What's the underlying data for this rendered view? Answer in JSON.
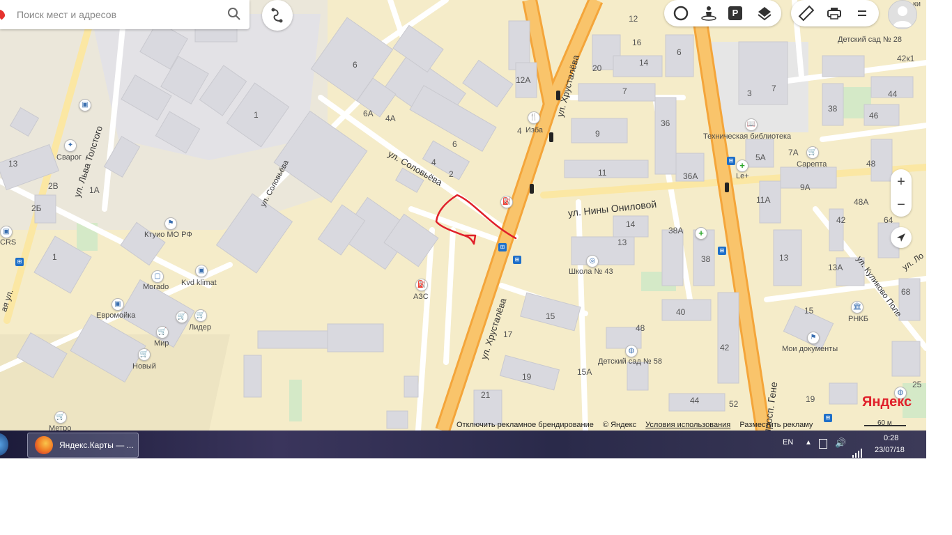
{
  "search": {
    "placeholder": "Поиск мест и адресов"
  },
  "map": {
    "streets": [
      "ул. Хрусталёва",
      "ул. Хрусталёва",
      "ул. Соловьёва",
      "ул. Соловьёва",
      "ул. Льва Толстого",
      "ул. Нины Ониловой",
      "просп. Гене",
      "ул. Куликово Поле",
      "ул. Ло",
      "ая ул."
    ],
    "pois": [
      "Сварог",
      "Ктуио МО РФ",
      "Morado",
      "Kvd klimat",
      "Евромойка",
      "Лидер",
      "Мир",
      "Новый",
      "Метро",
      "АЗС",
      "Изба",
      "Техническая библиотека",
      "Сарепта",
      "Le+",
      "Школа № 43",
      "Детский сад № 58",
      "Детский сад № 28",
      "РНКБ",
      "Мои документы",
      "CRS",
      "ки"
    ],
    "house_numbers": [
      "6",
      "1",
      "6А",
      "4А",
      "6",
      "4",
      "2",
      "13",
      "2В",
      "2Б",
      "1А",
      "1",
      "12А",
      "4",
      "12",
      "16",
      "14",
      "6",
      "20",
      "7",
      "3",
      "7",
      "9",
      "36",
      "11",
      "36А",
      "38",
      "5А",
      "7А",
      "48",
      "42к1",
      "44",
      "46",
      "9А",
      "11А",
      "48А",
      "42",
      "64",
      "14",
      "13",
      "38А",
      "38",
      "13",
      "13А",
      "68",
      "40",
      "48",
      "42",
      "15",
      "15",
      "17",
      "19",
      "15А",
      "21",
      "44",
      "52",
      "25",
      "19"
    ],
    "scale": "60 м",
    "bottom_links": [
      "Отключить рекламное брендирование",
      "© Яндекс",
      "Условия использования",
      "Разместить рекламу"
    ],
    "logo": "Яндекс",
    "zoom_in": "+",
    "zoom_out": "−"
  },
  "toolbar": {
    "icons": [
      "traffic-icon",
      "panorama-icon",
      "parking-icon",
      "layers-icon",
      "ruler-icon",
      "print-icon",
      "menu-icon"
    ],
    "parking_label": "P"
  },
  "taskbar": {
    "window_title": "Яндекс.Карты — ...",
    "lang": "EN",
    "time": "0:28",
    "date": "23/07/18"
  },
  "colors": {
    "map_bg": "#f5ecc9",
    "main_road": "#f7b84e",
    "secondary_road": "#fbe7a3",
    "building": "#d8d8de",
    "route_annotation": "#e0202a"
  }
}
